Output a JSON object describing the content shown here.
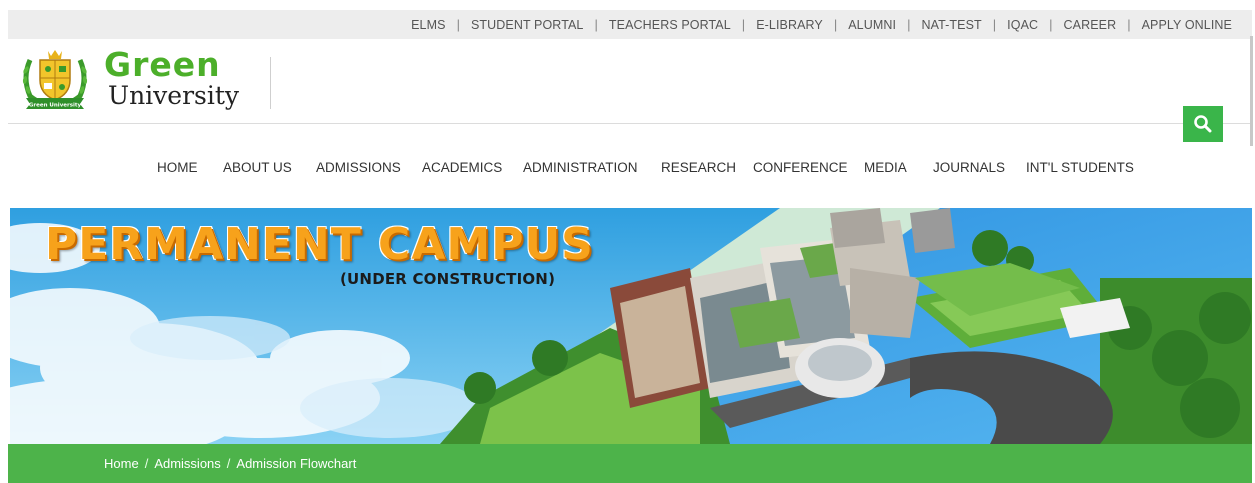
{
  "topbar": {
    "links": [
      "ELMS",
      "STUDENT PORTAL",
      "TEACHERS PORTAL",
      "E-LIBRARY",
      "ALUMNI",
      "NAT-TEST",
      "IQAC",
      "CAREER",
      "APPLY ONLINE"
    ],
    "separator": "|"
  },
  "brand": {
    "name_line1": "Green",
    "name_line2": "University",
    "emblem_text": "Green University"
  },
  "search": {
    "icon": "search-icon"
  },
  "nav": {
    "items": [
      "HOME",
      "ABOUT US",
      "ADMISSIONS",
      "ACADEMICS",
      "ADMINISTRATION",
      "RESEARCH",
      "CONFERENCE",
      "MEDIA",
      "JOURNALS",
      "INT'L STUDENTS"
    ]
  },
  "banner": {
    "title": "PERMANENT CAMPUS",
    "subtitle": "(UNDER CONSTRUCTION)"
  },
  "breadcrumb": {
    "items": [
      "Home",
      "Admissions",
      "Admission Flowchart"
    ],
    "separator": "/"
  },
  "colors": {
    "brand_green": "#4caf2a",
    "breadcrumb_bg": "#4db34a",
    "search_bg": "#3ab54a",
    "banner_title": "#f7a21b"
  }
}
